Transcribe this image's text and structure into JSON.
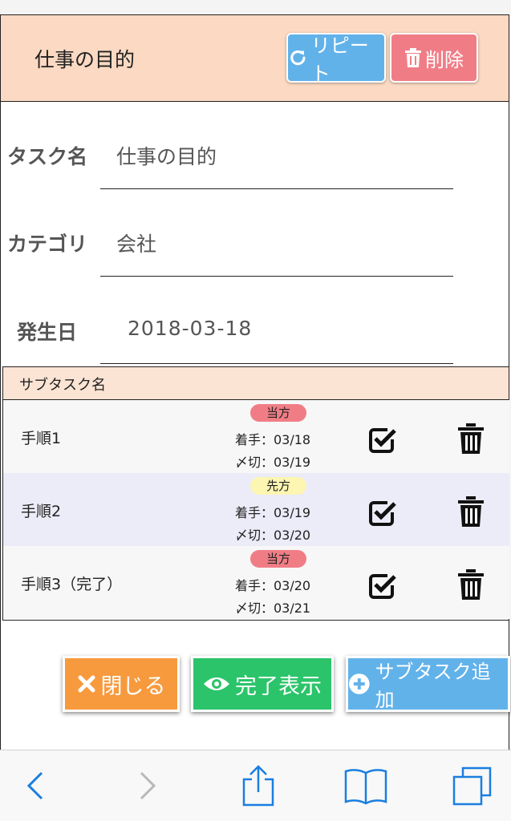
{
  "header": {
    "title": "仕事の目的",
    "repeat_label": "リピート",
    "delete_label": "削除"
  },
  "form": {
    "task_name_label": "タスク名",
    "task_name_value": "仕事の目的",
    "category_label": "カテゴリ",
    "category_value": "会社",
    "date_label": "発生日",
    "date_value": "2018-03-18"
  },
  "subtasks": {
    "header": "サブタスク名",
    "rows": [
      {
        "name": "手順1",
        "badge": "当方",
        "badge_color": "#f07d86",
        "start": "着手：03/18",
        "deadline": "〆切：03/19",
        "bg": "#f7f7f7"
      },
      {
        "name": "手順2",
        "badge": "先方",
        "badge_color": "#fdf5b2",
        "start": "着手：03/19",
        "deadline": "〆切：03/20",
        "bg": "#ecebf8"
      },
      {
        "name": "手順3（完了）",
        "badge": "当方",
        "badge_color": "#f07d86",
        "start": "着手：03/20",
        "deadline": "〆切：03/21",
        "bg": "#f7f7f7"
      }
    ]
  },
  "actions": {
    "close_label": "閉じる",
    "show_done_label": "完了表示",
    "add_subtask_label": "サブタスク追加"
  },
  "colors": {
    "header_bg": "#fbd9c2",
    "repeat": "#62b2ea",
    "delete": "#f07d86",
    "close": "#f79a3e",
    "show_done": "#2bc46a",
    "add_subtask": "#62b2ea",
    "ios_blue": "#1a7ee0"
  },
  "icons": [
    "refresh-icon",
    "trash-icon",
    "check-icon",
    "close-x-icon",
    "eye-icon",
    "plus-circle-icon",
    "back-icon",
    "forward-icon",
    "share-icon",
    "bookmarks-icon",
    "tabs-icon"
  ]
}
